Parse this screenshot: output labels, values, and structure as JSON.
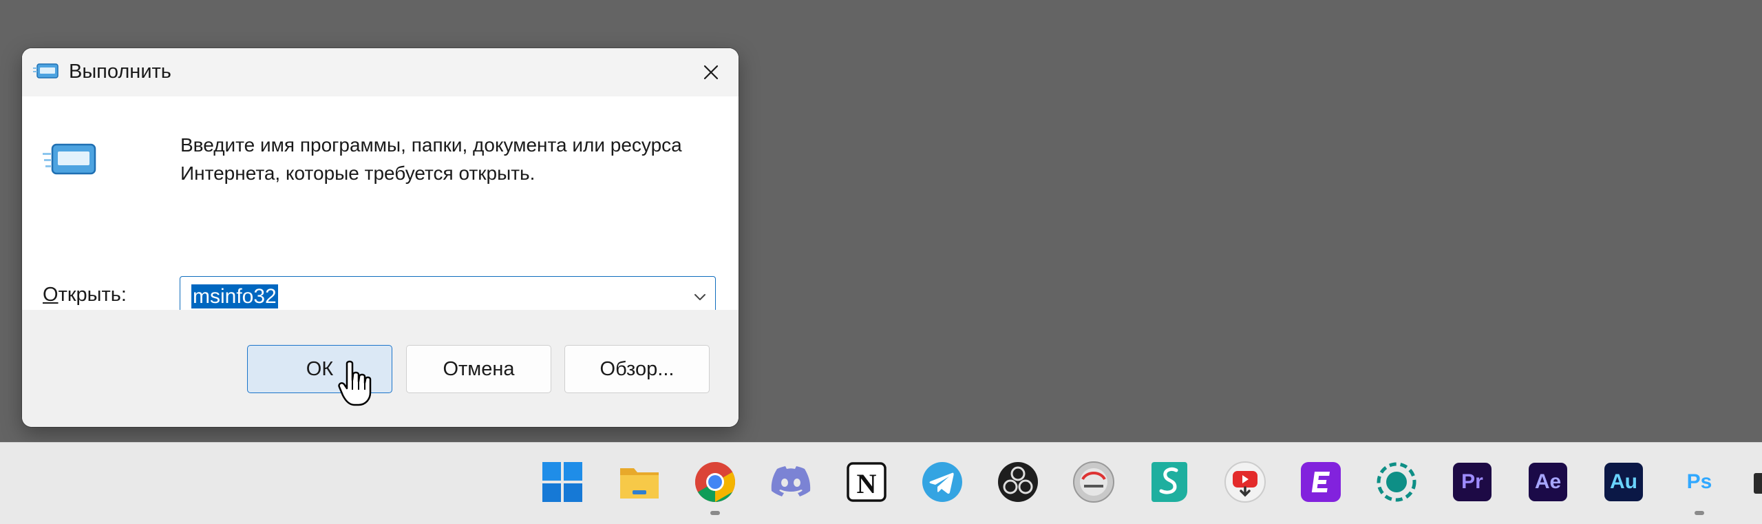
{
  "dialog": {
    "title": "Выполнить",
    "description": "Введите имя программы, папки, документа или ресурса Интернета, которые требуется открыть.",
    "open_label_accel": "О",
    "open_label_rest": "ткрыть:",
    "input_value": "msinfo32",
    "buttons": {
      "ok": "ОК",
      "cancel": "Отмена",
      "browse": "Обзор..."
    }
  },
  "taskbar": {
    "items": [
      {
        "name": "windows-start-icon"
      },
      {
        "name": "file-explorer-icon"
      },
      {
        "name": "chrome-icon",
        "running": true
      },
      {
        "name": "discord-icon"
      },
      {
        "name": "notion-icon",
        "glyph": "N"
      },
      {
        "name": "telegram-icon"
      },
      {
        "name": "obs-studio-icon"
      },
      {
        "name": "ultra-studio-icon"
      },
      {
        "name": "surfshark-icon",
        "glyph": "S"
      },
      {
        "name": "youtube-downloader-icon"
      },
      {
        "name": "elementor-icon",
        "glyph": "E"
      },
      {
        "name": "screen-recorder-icon"
      },
      {
        "name": "premiere-pro-icon",
        "glyph": "Pr"
      },
      {
        "name": "after-effects-icon",
        "glyph": "Ae"
      },
      {
        "name": "audition-icon",
        "glyph": "Au"
      },
      {
        "name": "photoshop-icon",
        "glyph": "Ps",
        "running": true
      }
    ]
  },
  "colors": {
    "desktop": "#646464",
    "accent": "#0067c0",
    "taskbar": "#e9e9e9"
  }
}
